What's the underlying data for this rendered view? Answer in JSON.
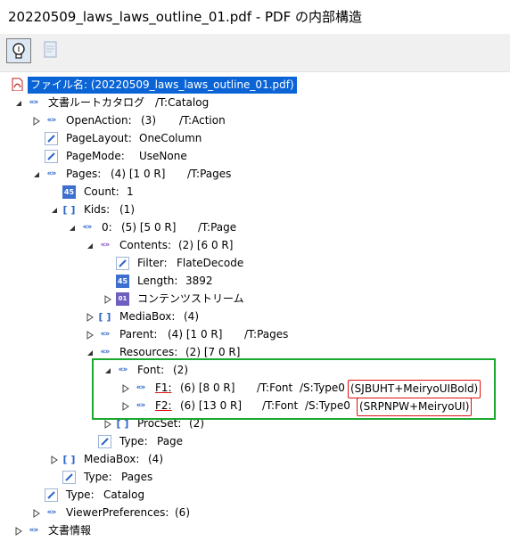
{
  "window": {
    "title": "20220509_laws_laws_outline_01.pdf - PDF の内部構造"
  },
  "toolbar": {
    "btn1": "lightbulb-icon",
    "btn2": "document-icon"
  },
  "tree": {
    "file": "ファイル名: (20220509_laws_laws_outline_01.pdf)",
    "catalog": {
      "name": "文書ルートカタログ",
      "type": "/T:Catalog"
    },
    "openaction": {
      "name": "OpenAction:",
      "count": "(3)",
      "type": "/T:Action"
    },
    "pagelayout": {
      "name": "PageLayout:",
      "value": "OneColumn"
    },
    "pagemode": {
      "name": "PageMode:",
      "value": "UseNone"
    },
    "pages": {
      "name": "Pages:",
      "info": "(4) [1 0 R]",
      "type": "/T:Pages"
    },
    "count": {
      "name": "Count:",
      "value": "1"
    },
    "kids": {
      "name": "Kids:",
      "value": "(1)"
    },
    "page0": {
      "name": "0:",
      "info": "(5) [5 0 R]",
      "type": "/T:Page"
    },
    "contents": {
      "name": "Contents:",
      "info": "(2) [6 0 R]"
    },
    "filter": {
      "name": "Filter:",
      "value": "FlateDecode"
    },
    "length": {
      "name": "Length:",
      "value": "3892"
    },
    "stream": {
      "name": "コンテンツストリーム"
    },
    "mediabox1": {
      "name": "MediaBox:",
      "value": "(4)"
    },
    "parent": {
      "name": "Parent:",
      "info": "(4) [1 0 R]",
      "type": "/T:Pages"
    },
    "resources": {
      "name": "Resources:",
      "info": "(2) [7 0 R]"
    },
    "font": {
      "name": "Font:",
      "value": "(2)"
    },
    "f1": {
      "name": "F1:",
      "info": "(6) [8 0 R]",
      "type": "/T:Font",
      "subtype": "/S:Type0",
      "base": "(SJBUHT+MeiryoUIBold)"
    },
    "f2": {
      "name": "F2:",
      "info": "(6) [13 0 R]",
      "type": "/T:Font",
      "subtype": "/S:Type0",
      "base": "(SRPNPW+MeiryoUI)"
    },
    "procset": {
      "name": "ProcSet:",
      "value": "(2)"
    },
    "ptype": {
      "name": "Type:",
      "value": "Page"
    },
    "mediabox2": {
      "name": "MediaBox:",
      "value": "(4)"
    },
    "pagestype": {
      "name": "Type:",
      "value": "Pages"
    },
    "cattype": {
      "name": "Type:",
      "value": "Catalog"
    },
    "viewerprefs": {
      "name": "ViewerPreferences:",
      "value": "(6)"
    },
    "docinfo": {
      "name": "文書情報"
    }
  },
  "colors": {
    "selection": "#0a64d6",
    "highlight_box": "#1ba82e",
    "underline": "#e01010"
  }
}
